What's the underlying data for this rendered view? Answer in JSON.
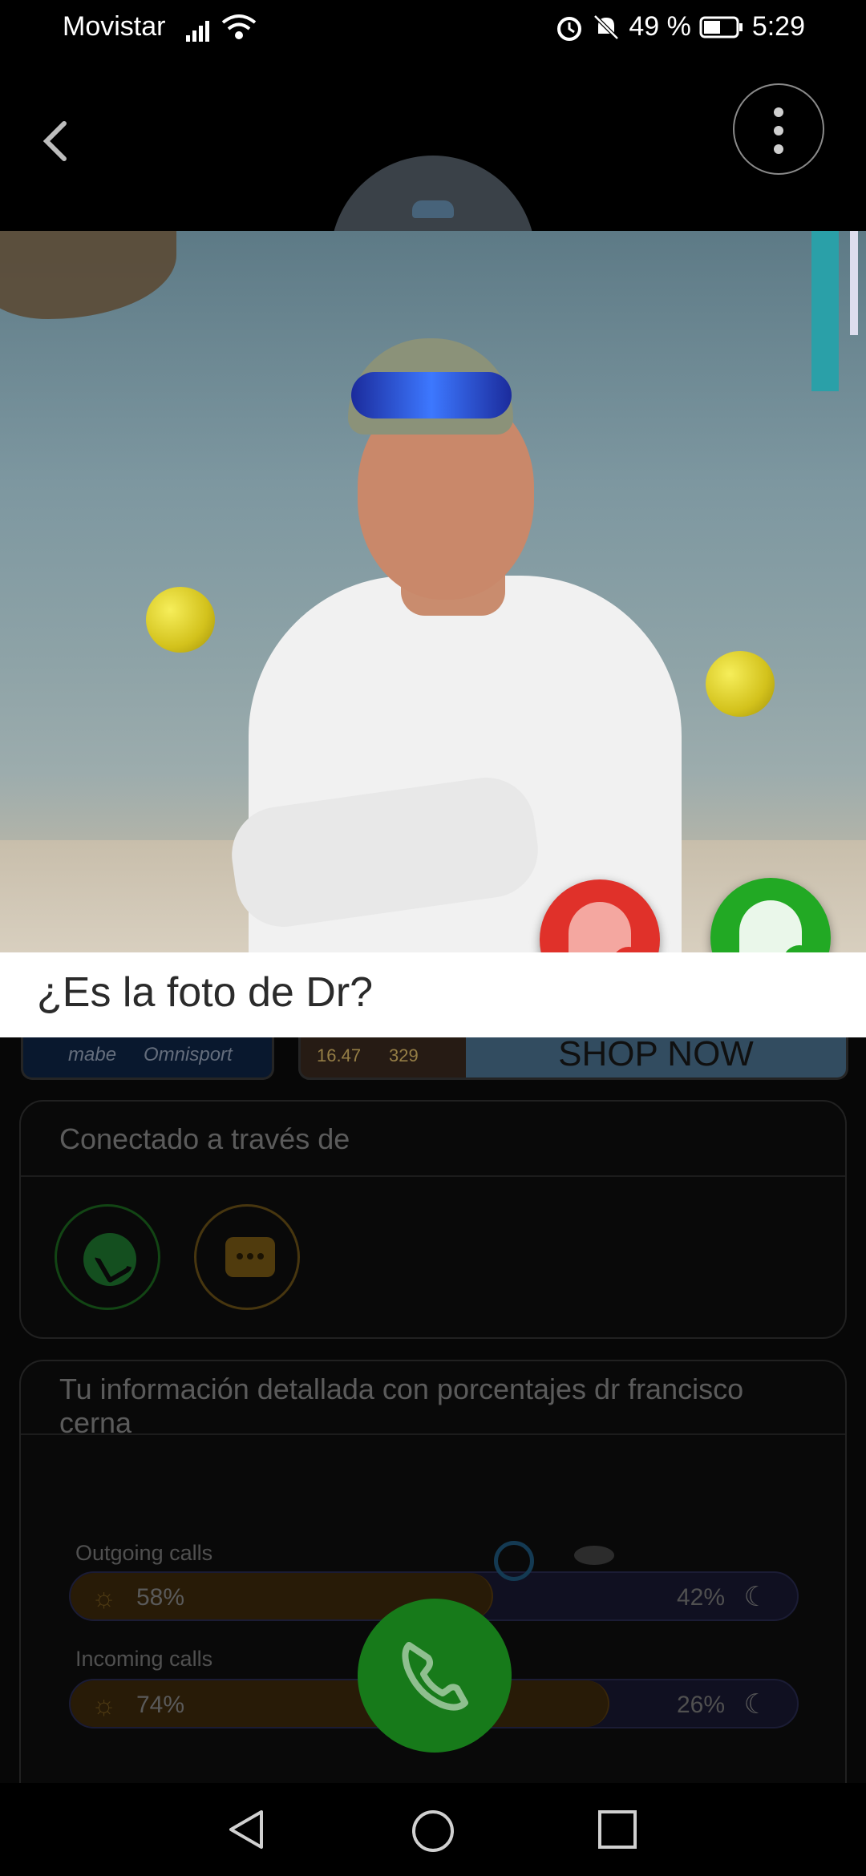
{
  "status_bar": {
    "carrier": "Movistar",
    "battery": "49 %",
    "time": "5:29",
    "icons": [
      "signal-icon",
      "wifi-icon",
      "alarm-icon",
      "mute-icon",
      "battery-icon"
    ]
  },
  "header": {
    "back_icon": "chevron-left-icon",
    "menu_icon": "more-vertical-icon"
  },
  "photo_prompt": {
    "question": "¿Es la foto de Dr?",
    "reject_icon": "reject-person-icon",
    "accept_icon": "accept-person-icon"
  },
  "ads": {
    "ad1_left": "mabe",
    "ad1_right": "Omnisport",
    "ad2_price1": "16.47",
    "ad2_price2": "329",
    "ad2_cta": "SHOP NOW"
  },
  "connected": {
    "title": "Conectado a través de",
    "channels": [
      "whatsapp-icon",
      "sms-icon"
    ]
  },
  "details": {
    "title": "Tu información detallada con porcentajes dr francisco cerna",
    "outgoing": {
      "label": "Outgoing calls",
      "day": "58%",
      "night": "42%",
      "day_fraction": 0.58
    },
    "incoming": {
      "label": "Incoming calls",
      "day": "74%",
      "night": "26%",
      "day_fraction": 0.74
    }
  },
  "colors": {
    "accept": "#22a924",
    "reject": "#e0312a",
    "call_fab": "#177a1a"
  }
}
